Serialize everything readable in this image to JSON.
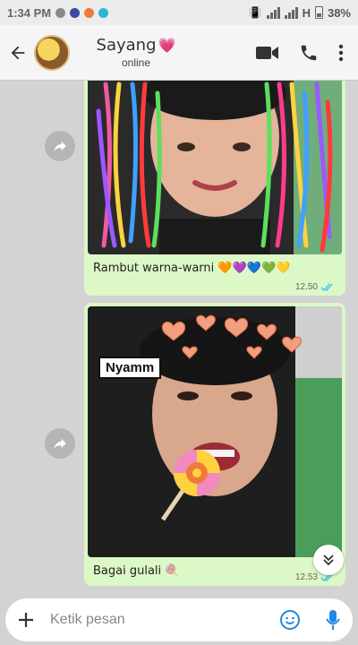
{
  "status_bar": {
    "time": "1:34 PM",
    "network": "H",
    "battery": "38%"
  },
  "header": {
    "contact_name": "Sayang",
    "status": "online"
  },
  "messages": [
    {
      "caption": "Rambut warna-warni",
      "emojis": "🧡💜💙💚💛",
      "time": "12.50"
    },
    {
      "caption": "Bagai gulali",
      "emojis": "🍭",
      "time": "12.53",
      "sticker_text": "Nyamm"
    }
  ],
  "composer": {
    "placeholder": "Ketik pesan"
  },
  "colors": {
    "bubble": "#dcf8c6",
    "chat_bg": "#d3d3d3",
    "read_ticks": "#4fc3f7"
  }
}
